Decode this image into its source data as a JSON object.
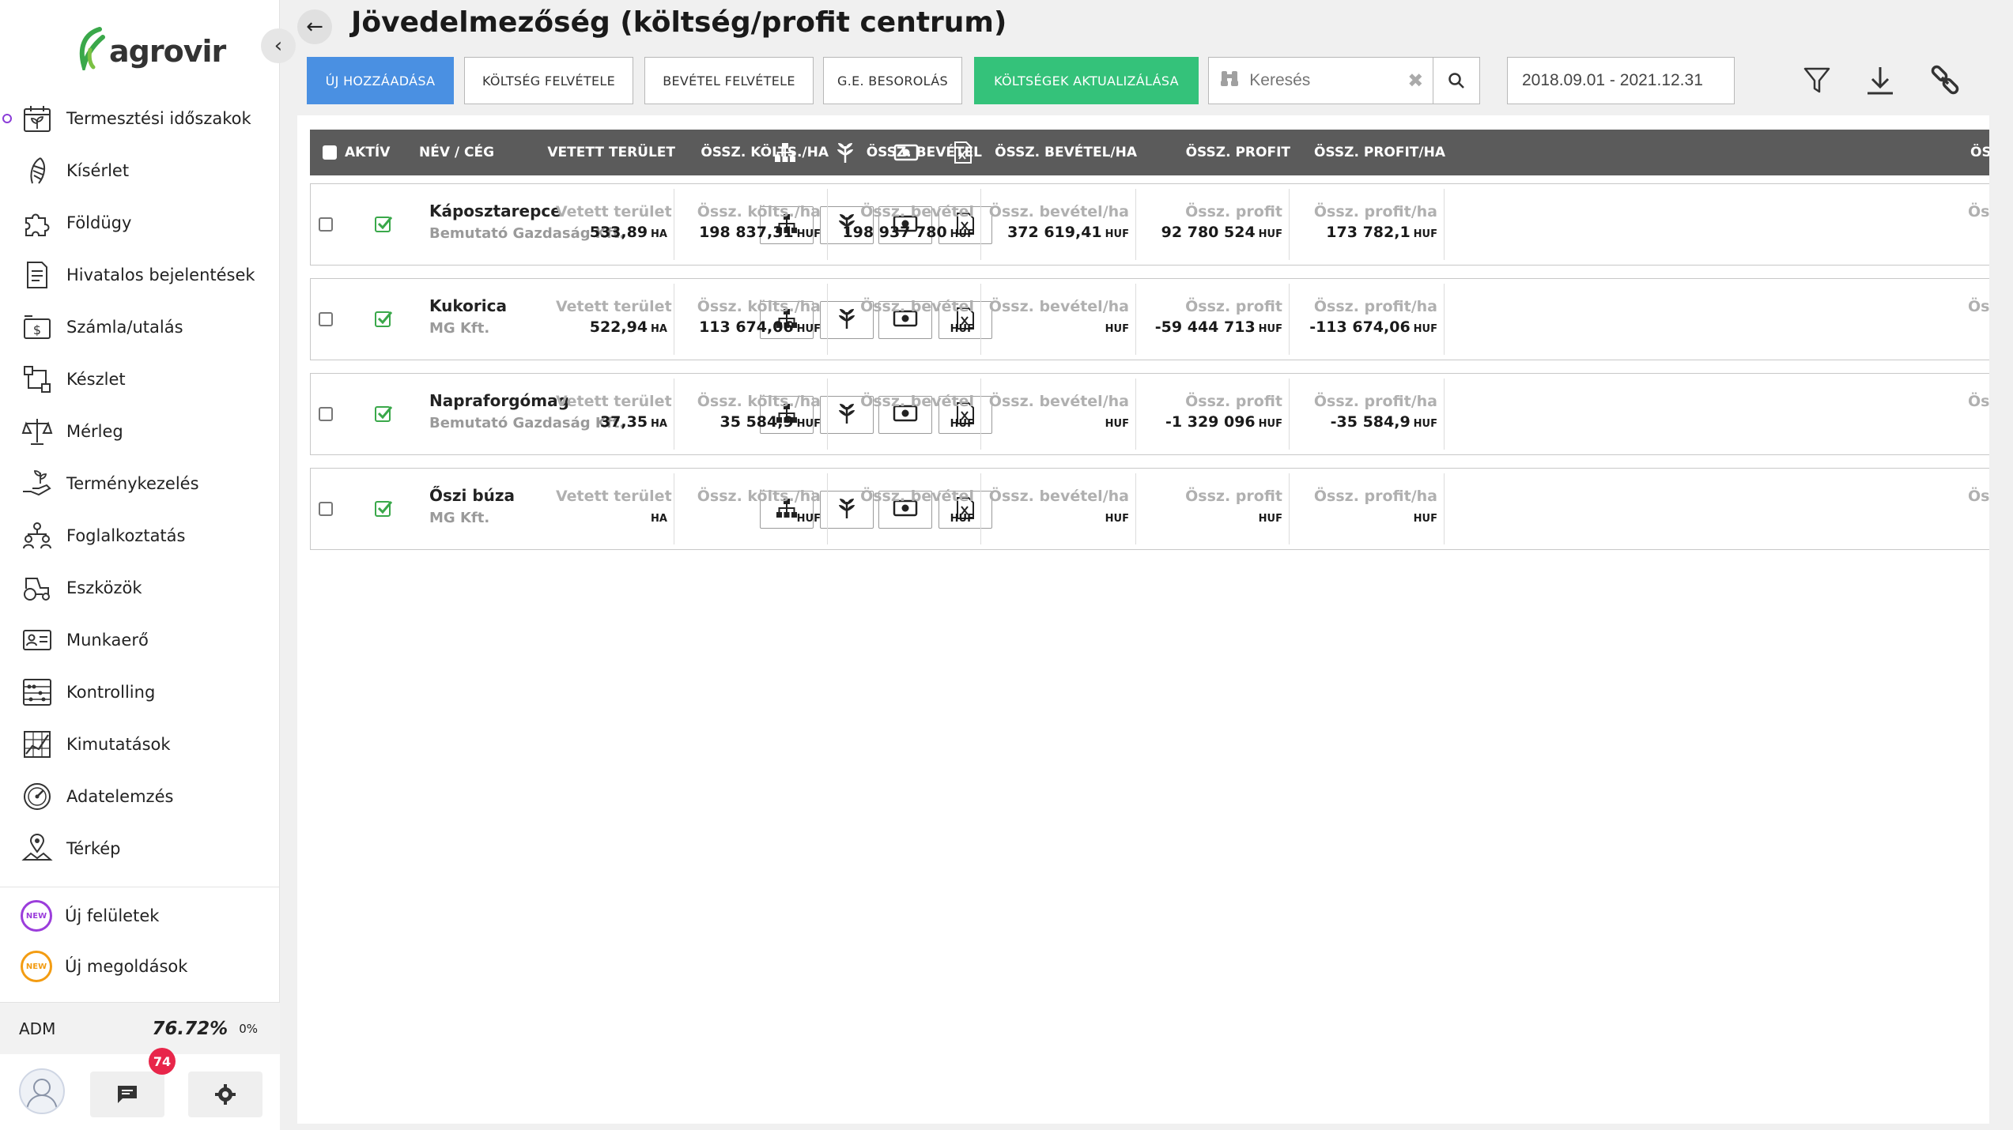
{
  "sidebar": {
    "logo_text": "agrovir",
    "nav": [
      {
        "label": "Termesztési időszakok",
        "icon": "calendar-leaf-icon"
      },
      {
        "label": "Kísérlet",
        "icon": "wheat-icon"
      },
      {
        "label": "Földügy",
        "icon": "puzzle-icon"
      },
      {
        "label": "Hivatalos bejelentések",
        "icon": "document-icon"
      },
      {
        "label": "Számla/utalás",
        "icon": "invoice-dollar-icon"
      },
      {
        "label": "Készlet",
        "icon": "inventory-icon"
      },
      {
        "label": "Mérleg",
        "icon": "scale-icon"
      },
      {
        "label": "Terménykezelés",
        "icon": "harvest-hand-icon"
      },
      {
        "label": "Foglalkoztatás",
        "icon": "employment-icon"
      },
      {
        "label": "Eszközök",
        "icon": "tractor-icon"
      },
      {
        "label": "Munkaerő",
        "icon": "id-card-icon"
      },
      {
        "label": "Kontrolling",
        "icon": "abacus-icon"
      },
      {
        "label": "Kimutatások",
        "icon": "chart-grid-icon"
      },
      {
        "label": "Adatelemzés",
        "icon": "gauge-icon"
      },
      {
        "label": "Térkép",
        "icon": "map-pin-icon"
      }
    ],
    "new_items": [
      {
        "label": "Új felületek",
        "badge": "NEW",
        "color": "#9b3ddb"
      },
      {
        "label": "Új megoldások",
        "badge": "NEW",
        "color": "#f39c12"
      }
    ],
    "adm_label": "ADM",
    "adm_percent": "76.72%",
    "adm_small": "0%",
    "messages_badge": "74"
  },
  "header": {
    "title": "Jövedelmezőség (költség/profit centrum)",
    "buttons": {
      "new": "ÚJ HOZZÁADÁSA",
      "cost": "KÖLTSÉG FELVÉTELE",
      "income": "BEVÉTEL FELVÉTELE",
      "ge": "G.E. BESOROLÁS",
      "update": "KÖLTSÉGEK AKTUALIZÁLÁSA"
    },
    "search_placeholder": "Keresés",
    "date_range": "2018.09.01 - 2021.12.31"
  },
  "table": {
    "columns": {
      "active": "AKTÍV",
      "name": "NÉV / CÉG",
      "area": "VETETT TERÜLET",
      "cost_ha": "ÖSSZ. KÖLTS./HA",
      "income": "ÖSSZ. BEVÉTEL",
      "income_ha": "ÖSSZ. BEVÉTEL/HA",
      "profit": "ÖSSZ. PROFIT",
      "profit_ha": "ÖSSZ. PROFIT/HA",
      "more": "ÖS"
    },
    "labels": {
      "area": "Vetett terület",
      "cost_ha": "Össz. költs./ha",
      "income": "Össz. bevétel",
      "income_ha": "Össz. bevétel/ha",
      "profit": "Össz. profit",
      "profit_ha": "Össz. profit/ha",
      "more": "Öss"
    },
    "units": {
      "ha": "HA",
      "huf": "HUF"
    },
    "rows": [
      {
        "name": "Káposztarepce",
        "company": "Bemutató Gazdaság Kft.",
        "area": "533,89",
        "cost_ha": "198 837,31",
        "income": "198 937 780",
        "income_ha": "372 619,41",
        "profit": "92 780 524",
        "profit_ha": "173 782,1"
      },
      {
        "name": "Kukorica",
        "company": "MG Kft.",
        "area": "522,94",
        "cost_ha": "113 674,06",
        "income": "",
        "income_ha": "",
        "profit": "-59 444 713",
        "profit_ha": "-113 674,06"
      },
      {
        "name": "Napraforgómag",
        "company": "Bemutató Gazdaság Kft.",
        "area": "37,35",
        "cost_ha": "35 584,9",
        "income": "",
        "income_ha": "",
        "profit": "-1 329 096",
        "profit_ha": "-35 584,9"
      },
      {
        "name": "Őszi búza",
        "company": "MG Kft.",
        "area": "",
        "cost_ha": "",
        "income": "",
        "income_ha": "",
        "profit": "",
        "profit_ha": ""
      }
    ]
  }
}
